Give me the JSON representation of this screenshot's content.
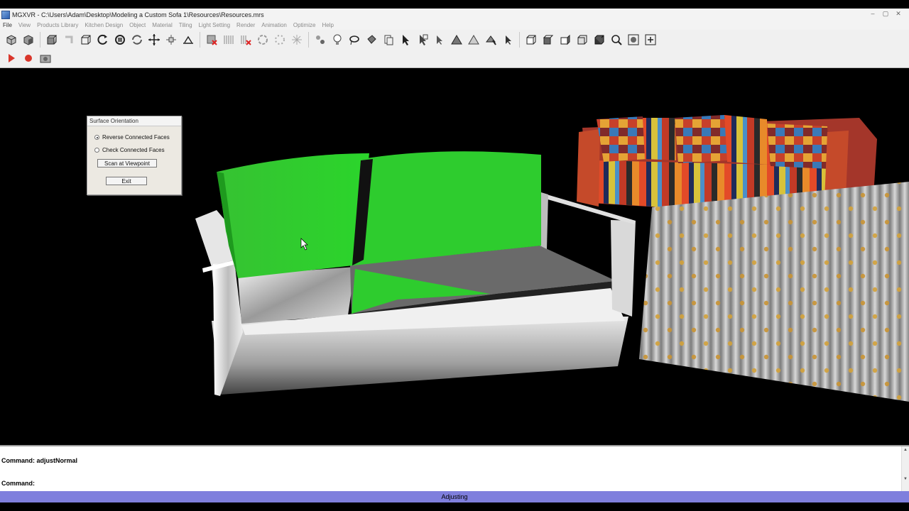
{
  "window": {
    "title": "MGXVR - C:\\Users\\Adam\\Desktop\\Modeling a Custom Sofa 1\\Resources\\Resources.mrs",
    "minimize": "–",
    "maximize": "▢",
    "close": "✕"
  },
  "menu": [
    {
      "label": "File",
      "enabled": true
    },
    {
      "label": "View",
      "enabled": false
    },
    {
      "label": "Products Library",
      "enabled": false
    },
    {
      "label": "Kitchen Design",
      "enabled": false
    },
    {
      "label": "Object",
      "enabled": false
    },
    {
      "label": "Material",
      "enabled": false
    },
    {
      "label": "Tiling",
      "enabled": false
    },
    {
      "label": "Light Setting",
      "enabled": false
    },
    {
      "label": "Render",
      "enabled": false
    },
    {
      "label": "Animation",
      "enabled": false
    },
    {
      "label": "Optimize",
      "enabled": false
    },
    {
      "label": "Help",
      "enabled": false
    }
  ],
  "dialog": {
    "title": "Surface Orientation",
    "options": [
      {
        "label": "Reverse Connected Faces",
        "checked": true
      },
      {
        "label": "Check Connected Faces",
        "checked": false
      }
    ],
    "scan_button": "Scan at Viewpoint",
    "exit_button": "Exit"
  },
  "command": {
    "history": "Command: adjustNormal",
    "prompt": "Command:"
  },
  "status": {
    "text": "Adjusting"
  },
  "colors": {
    "status_bar": "#7f7fdd",
    "face_green": "#2ecc2e",
    "play_red": "#d9362b"
  }
}
